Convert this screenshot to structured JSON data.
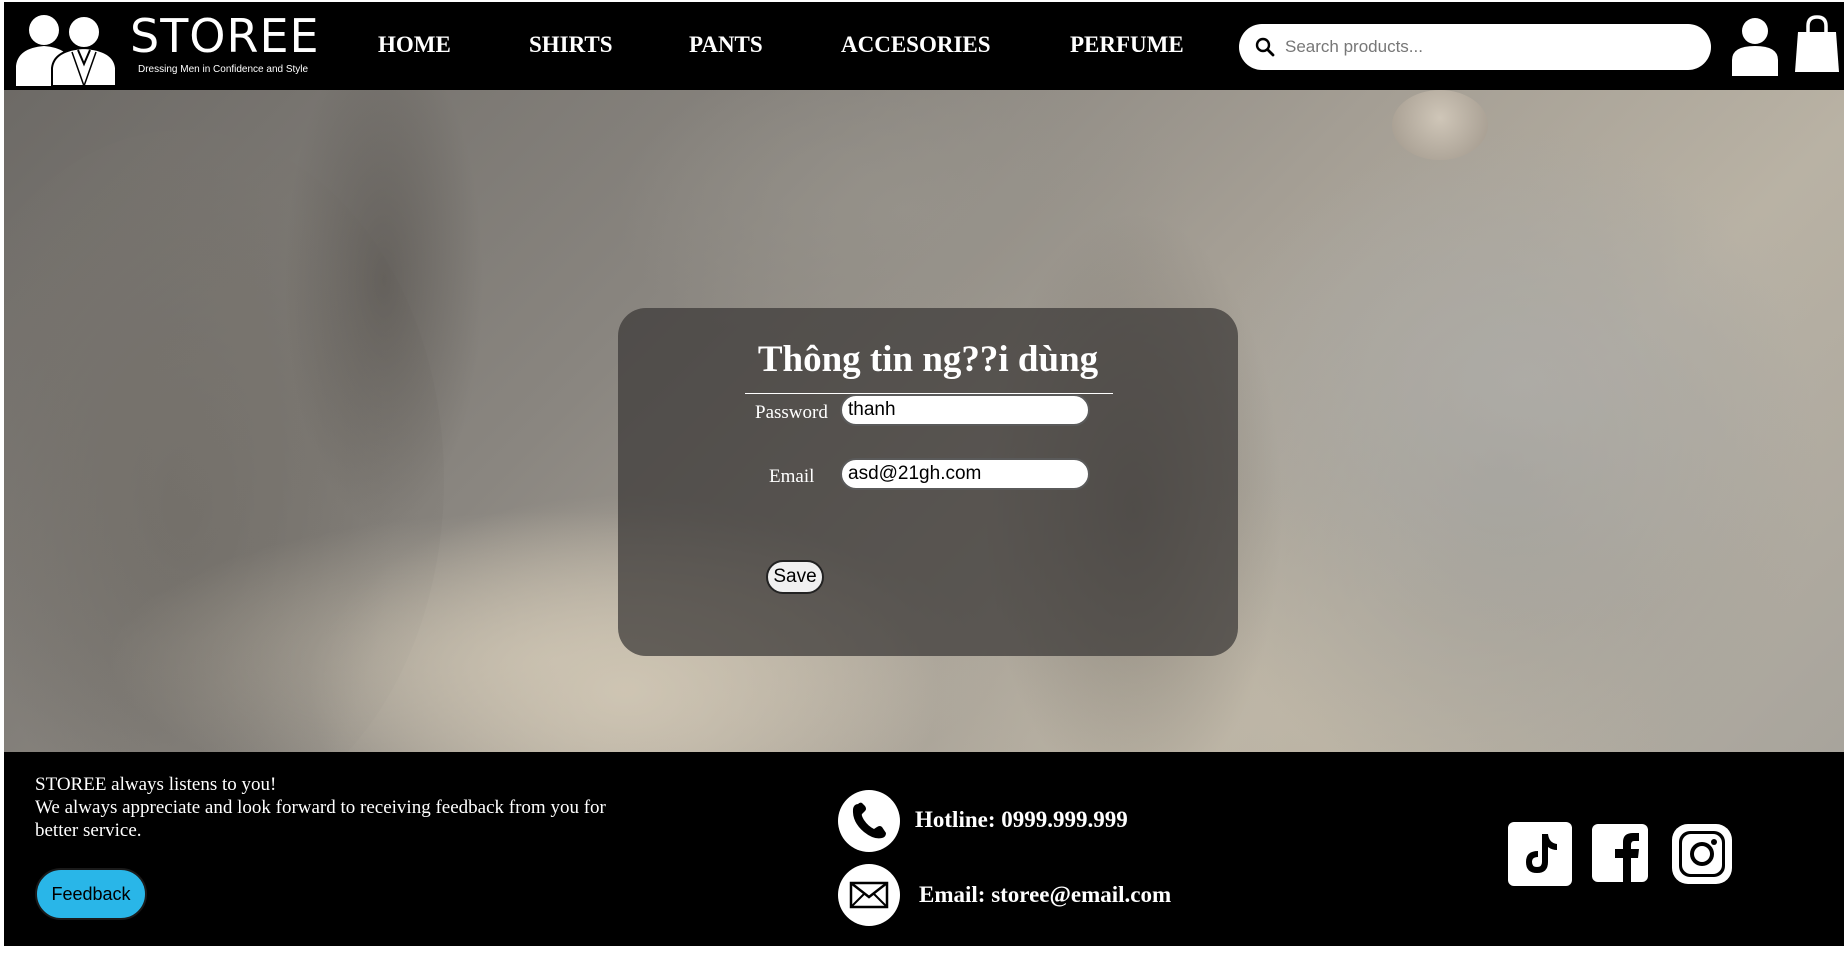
{
  "brand": {
    "name": "STOREE",
    "tagline": "Dressing Men in Confidence and Style"
  },
  "nav": {
    "items": [
      {
        "label": "HOME"
      },
      {
        "label": "SHIRTS"
      },
      {
        "label": "PANTS"
      },
      {
        "label": "ACCESORIES"
      },
      {
        "label": "PERFUME"
      }
    ]
  },
  "search": {
    "placeholder": "Search products...",
    "value": ""
  },
  "profile_form": {
    "title": "Thông tin ng??i dùng",
    "password_label": "Password",
    "password_value": "thanh",
    "email_label": "Email",
    "email_value": "asd@21gh.com",
    "save_label": "Save"
  },
  "footer": {
    "line1": "STOREE always listens to you!",
    "line2": "We always appreciate and look forward to receiving feedback from you for better service.",
    "feedback_label": "Feedback",
    "hotline": "Hotline: 0999.999.999",
    "email": "Email: storee@email.com"
  },
  "colors": {
    "header_bg": "#000000",
    "footer_bg": "#000000",
    "feedback_button": "#29b6e8",
    "panel_bg": "rgba(58,56,54,0.72)"
  },
  "icons": [
    "search-icon",
    "user-icon",
    "shopping-bag-icon",
    "phone-icon",
    "envelope-icon",
    "tiktok-icon",
    "facebook-icon",
    "instagram-icon"
  ]
}
